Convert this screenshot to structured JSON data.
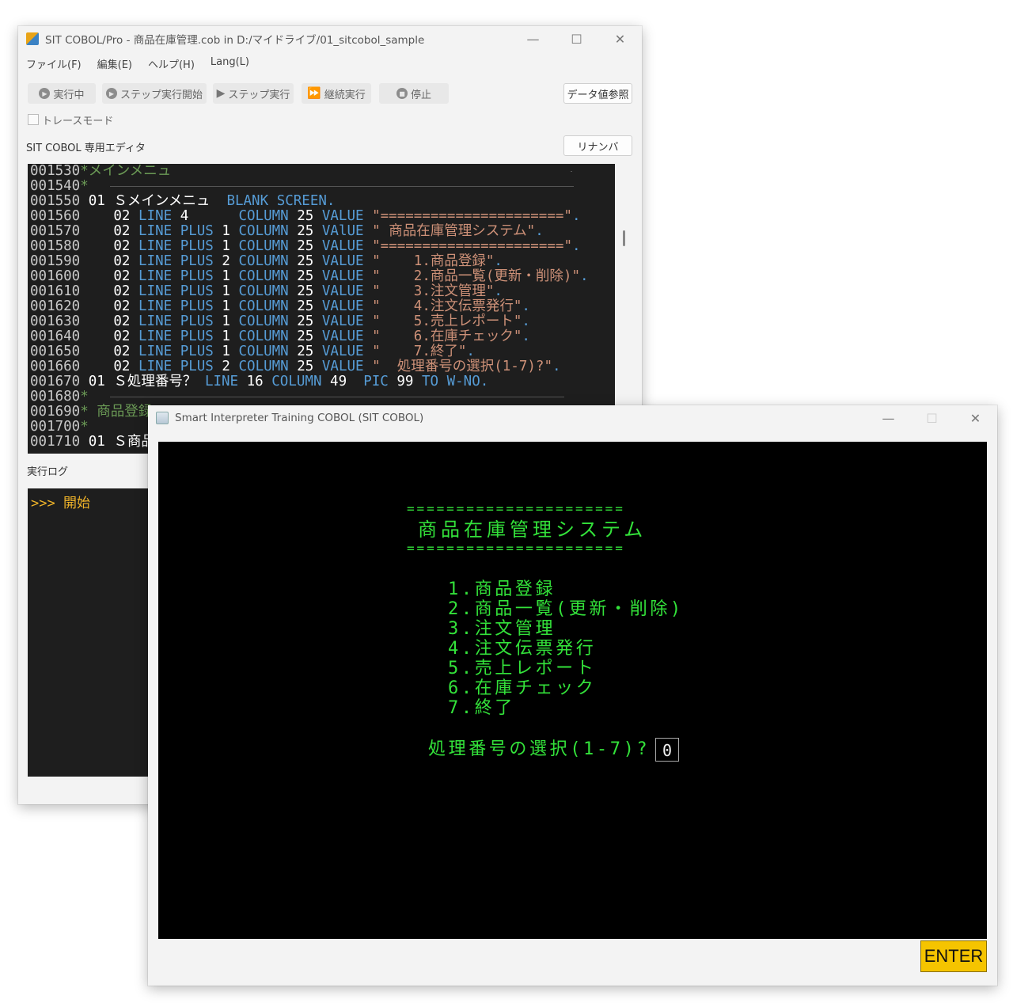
{
  "ide": {
    "title": "SIT COBOL/Pro - 商品在庫管理.cob in D:/マイドライブ/01_sitcobol_sample",
    "menu": [
      "ファイル(F)",
      "編集(E)",
      "ヘルプ(H)",
      "Lang(L)"
    ],
    "toolbar": {
      "running": "実行中",
      "step_start": "ステップ実行開始",
      "step": "ステップ実行",
      "continue": "継続実行",
      "stop": "停止",
      "data_ref": "データ値参照"
    },
    "trace_mode": "トレースモード",
    "editor_label": "SIT COBOL 専用エディタ",
    "renumber": "リナンバ",
    "log_label": "実行ログ",
    "log_text": ">>> 開始"
  },
  "code": {
    "l1530": {
      "num": "001530",
      "star": "*",
      "text": "メインメニュ"
    },
    "l1540": {
      "num": "001540",
      "star": "*"
    },
    "l1550": {
      "num": "001550",
      "lvl": "01",
      "name": "Ｓメインメニュ",
      "kw1": "BLANK",
      "kw2": "SCREEN."
    },
    "l1560": {
      "num": "001560",
      "lvl": "02",
      "line": "LINE",
      "n": "4",
      "col": "COLUMN",
      "c": "25",
      "val": "VALUE",
      "str": "\"======================\"",
      "dot": "."
    },
    "l1570": {
      "num": "001570",
      "lvl": "02",
      "line": "LINE",
      "plus": "PLUS",
      "n": "1",
      "col": "COLUMN",
      "c": "25",
      "val": "VAlUE",
      "str": "\" 商品在庫管理システム\"",
      "dot": "."
    },
    "l1580": {
      "num": "001580",
      "lvl": "02",
      "line": "LINE",
      "plus": "PLUS",
      "n": "1",
      "col": "COLUMN",
      "c": "25",
      "val": "VALUE",
      "str": "\"======================\"",
      "dot": "."
    },
    "l1590": {
      "num": "001590",
      "lvl": "02",
      "line": "LINE",
      "plus": "PLUS",
      "n": "2",
      "col": "COLUMN",
      "c": "25",
      "val": "VALUE",
      "str": "\"    1.商品登録\"",
      "dot": "."
    },
    "l1600": {
      "num": "001600",
      "lvl": "02",
      "line": "LINE",
      "plus": "PLUS",
      "n": "1",
      "col": "COLUMN",
      "c": "25",
      "val": "VALUE",
      "str": "\"    2.商品一覧(更新・削除)\"",
      "dot": "."
    },
    "l1610": {
      "num": "001610",
      "lvl": "02",
      "line": "LINE",
      "plus": "PLUS",
      "n": "1",
      "col": "COLUMN",
      "c": "25",
      "val": "VALUE",
      "str": "\"    3.注文管理\"",
      "dot": "."
    },
    "l1620": {
      "num": "001620",
      "lvl": "02",
      "line": "LINE",
      "plus": "PLUS",
      "n": "1",
      "col": "COLUMN",
      "c": "25",
      "val": "VALUE",
      "str": "\"    4.注文伝票発行\"",
      "dot": "."
    },
    "l1630": {
      "num": "001630",
      "lvl": "02",
      "line": "LINE",
      "plus": "PLUS",
      "n": "1",
      "col": "COLUMN",
      "c": "25",
      "val": "VALUE",
      "str": "\"    5.売上レポート\"",
      "dot": "."
    },
    "l1640": {
      "num": "001640",
      "lvl": "02",
      "line": "LINE",
      "plus": "PLUS",
      "n": "1",
      "col": "COLUMN",
      "c": "25",
      "val": "VALUE",
      "str": "\"    6.在庫チェック\"",
      "dot": "."
    },
    "l1650": {
      "num": "001650",
      "lvl": "02",
      "line": "LINE",
      "plus": "PLUS",
      "n": "1",
      "col": "COLUMN",
      "c": "25",
      "val": "VALUE",
      "str": "\"    7.終了\"",
      "dot": "."
    },
    "l1660": {
      "num": "001660",
      "lvl": "02",
      "line": "LINE",
      "plus": "PLUS",
      "n": "2",
      "col": "COLUMN",
      "c": "25",
      "val": "VALUE",
      "str": "\"  処理番号の選択(1-7)?\"",
      "dot": "."
    },
    "l1670": {
      "num": "001670",
      "lvl": "01",
      "name": "Ｓ処理番号？",
      "line": "LINE",
      "n": "16",
      "col": "COLUMN",
      "c": "49",
      "pic": "PIC",
      "p": "99",
      "to": "TO",
      "var": "W-NO."
    },
    "l1680": {
      "num": "001680",
      "star": "*"
    },
    "l1690": {
      "num": "001690",
      "star": "*",
      "text": " 商品登録"
    },
    "l1700": {
      "num": "001700",
      "star": "*"
    },
    "l1710": {
      "num": "001710",
      "lvl": "01",
      "name": "Ｓ商品"
    }
  },
  "terminal": {
    "title": "Smart Interpreter Training COBOL (SIT COBOL)",
    "rule_top": "======================",
    "heading": "商品在庫管理システム",
    "rule_bottom": "======================",
    "items": [
      "1.商品登録",
      "2.商品一覧(更新・削除)",
      "3.注文管理",
      "4.注文伝票発行",
      "5.売上レポート",
      "6.在庫チェック",
      "7.終了"
    ],
    "prompt": "処理番号の選択(1-7)?",
    "input_value": "0",
    "enter_label": "ENTER"
  },
  "colors": {
    "terminal_text": "#33e23a",
    "enter_button": "#f5c400",
    "log_text": "#f0b429",
    "keyword": "#569cd6",
    "string": "#ce9178",
    "comment": "#6a9955"
  }
}
